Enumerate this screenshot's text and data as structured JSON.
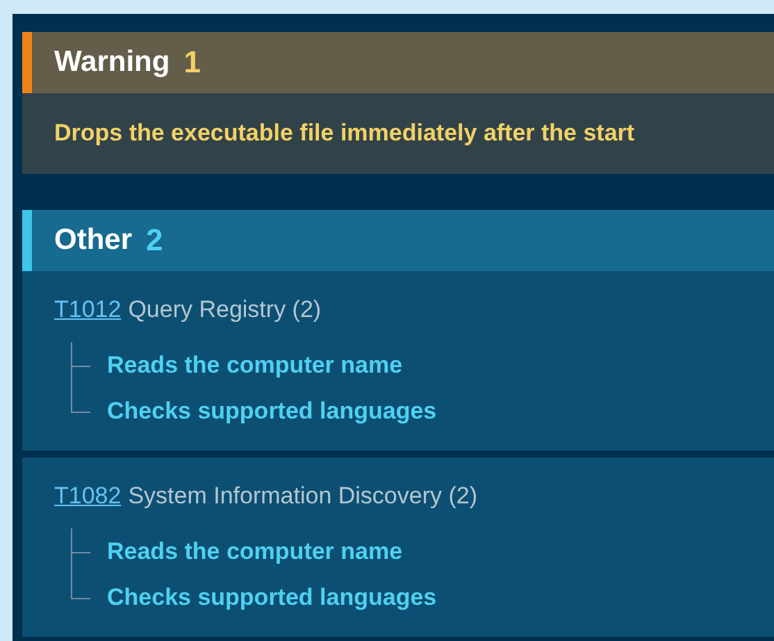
{
  "sections": [
    {
      "kind": "warning",
      "title": "Warning",
      "count": "1",
      "items": [
        "Drops the executable file immediately after the start"
      ]
    },
    {
      "kind": "other",
      "title": "Other",
      "count": "2",
      "techniques": [
        {
          "id": "T1012",
          "name": "Query Registry (2)",
          "behaviors": [
            "Reads the computer name",
            "Checks supported languages"
          ]
        },
        {
          "id": "T1082",
          "name": "System Information Discovery (2)",
          "behaviors": [
            "Reads the computer name",
            "Checks supported languages"
          ]
        }
      ]
    }
  ]
}
